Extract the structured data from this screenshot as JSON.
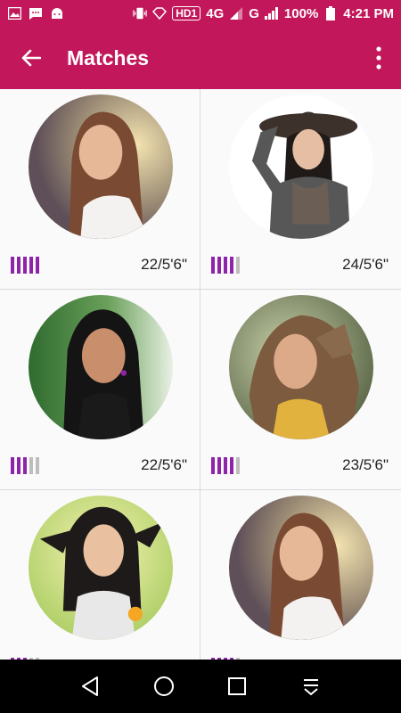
{
  "status_bar": {
    "hd_badge": "HD1",
    "network_4g": "4G",
    "network_g": "G",
    "battery": "100%",
    "time": "4:21 PM"
  },
  "app_bar": {
    "title": "Matches",
    "back_icon": "arrow-back-icon",
    "menu_icon": "more-vert-icon"
  },
  "matches": [
    {
      "info": "22/5'6\"",
      "match_level": 5,
      "match_max": 5
    },
    {
      "info": "24/5'6\"",
      "match_level": 4,
      "match_max": 5
    },
    {
      "info": "22/5'6\"",
      "match_level": 3,
      "match_max": 5
    },
    {
      "info": "23/5'6\"",
      "match_level": 4,
      "match_max": 5
    },
    {
      "info": "",
      "match_level": 3,
      "match_max": 5
    },
    {
      "info": "",
      "match_level": 4,
      "match_max": 5
    }
  ],
  "colors": {
    "primary": "#c2185b",
    "match_bar_active": "#8e24aa",
    "match_bar_inactive": "#bdbdbd"
  }
}
